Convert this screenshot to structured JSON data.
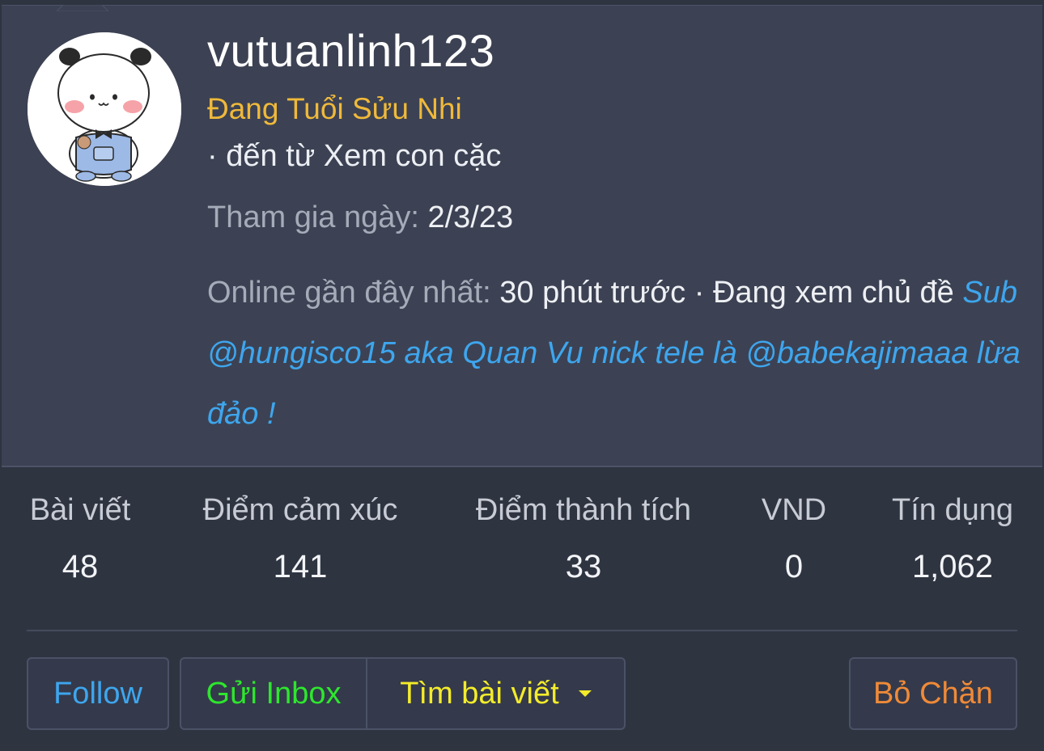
{
  "profile": {
    "username": "vutuanlinh123",
    "user_title": "Đang Tuổi Sửu Nhi",
    "location": "· đến từ Xem con cặc",
    "joined_label": "Tham gia ngày:",
    "joined_value": "2/3/23",
    "online_label": "Online gần đây nhất:",
    "online_value": "30 phút trước · Đang xem chủ đề",
    "online_thread": "Sub @hungisco15 aka Quan Vu nick tele là @babekajimaaa lừa đảo !"
  },
  "stats": [
    {
      "label": "Bài viết",
      "value": "48"
    },
    {
      "label": "Điểm cảm xúc",
      "value": "141"
    },
    {
      "label": "Điểm thành tích",
      "value": "33"
    },
    {
      "label": "VND",
      "value": "0"
    },
    {
      "label": "Tín dụng",
      "value": "1,062"
    }
  ],
  "actions": {
    "follow": "Follow",
    "inbox": "Gửi Inbox",
    "find_posts": "Tìm bài viết",
    "unblock": "Bỏ Chặn"
  },
  "colors": {
    "background": "#2f3441",
    "header_panel": "#3c4253",
    "user_title": "#f0b93a",
    "link": "#3ea6ee",
    "inbox": "#2ee62e",
    "find_posts": "#f4ec2a",
    "unblock": "#f08a38"
  },
  "icons": {
    "avatar": "panda-avatar",
    "dropdown": "caret-down-icon"
  }
}
